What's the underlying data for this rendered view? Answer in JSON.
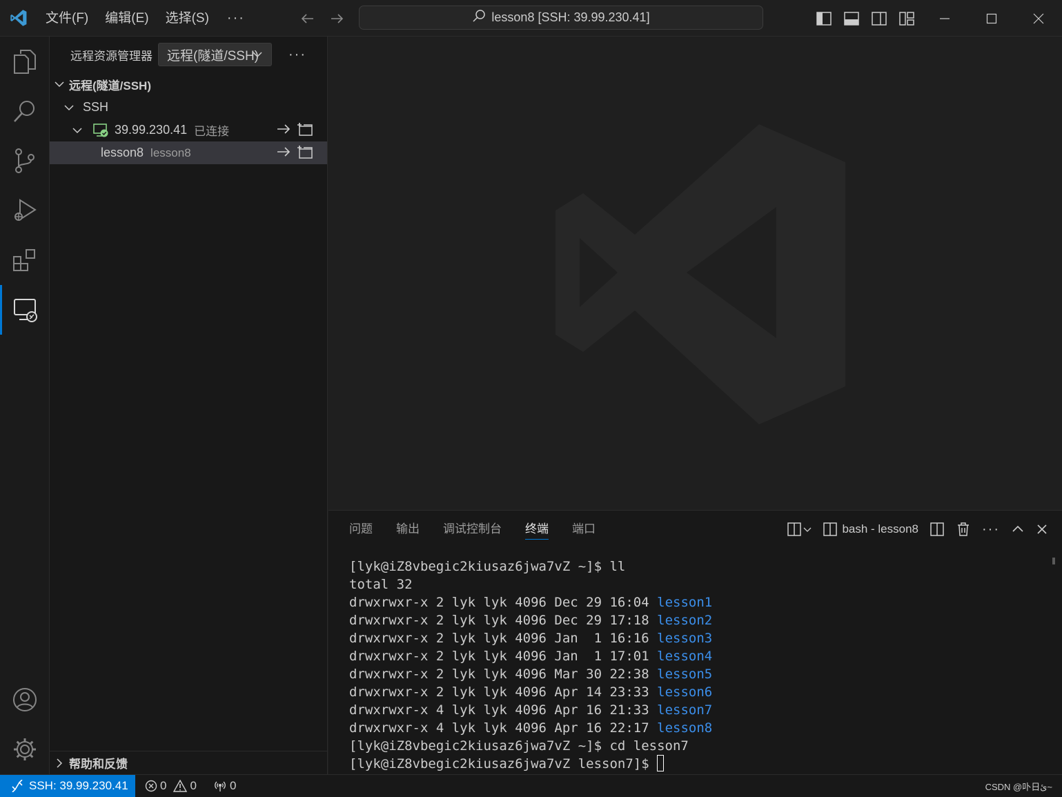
{
  "titlebar": {
    "menu": [
      "文件(F)",
      "编辑(E)",
      "选择(S)"
    ],
    "more": "···",
    "command_center": "lesson8 [SSH: 39.99.230.41]"
  },
  "sidebar": {
    "title": "远程资源管理器",
    "select_value": "远程(隧道/SSH)",
    "more": "···",
    "section": "远程(隧道/SSH)",
    "ssh_group": "SSH",
    "host": {
      "label": "39.99.230.41",
      "status": "已连接"
    },
    "folder": {
      "label": "lesson8",
      "desc": "lesson8"
    },
    "help_section": "帮助和反馈"
  },
  "panel": {
    "tabs": [
      "问题",
      "输出",
      "调试控制台",
      "终端",
      "端口"
    ],
    "active_tab": 3,
    "terminal_name": "bash - lesson8"
  },
  "terminal": {
    "lines": [
      {
        "text": "[lyk@iZ8vbegic2kiusaz6jwa7vZ ~]$ ll"
      },
      {
        "text": "total 32"
      },
      {
        "text": "drwxrwxr-x 2 lyk lyk 4096 Dec 29 16:04 ",
        "dir": "lesson1"
      },
      {
        "text": "drwxrwxr-x 2 lyk lyk 4096 Dec 29 17:18 ",
        "dir": "lesson2"
      },
      {
        "text": "drwxrwxr-x 2 lyk lyk 4096 Jan  1 16:16 ",
        "dir": "lesson3"
      },
      {
        "text": "drwxrwxr-x 2 lyk lyk 4096 Jan  1 17:01 ",
        "dir": "lesson4"
      },
      {
        "text": "drwxrwxr-x 2 lyk lyk 4096 Mar 30 22:38 ",
        "dir": "lesson5"
      },
      {
        "text": "drwxrwxr-x 2 lyk lyk 4096 Apr 14 23:33 ",
        "dir": "lesson6"
      },
      {
        "text": "drwxrwxr-x 4 lyk lyk 4096 Apr 16 21:33 ",
        "dir": "lesson7"
      },
      {
        "text": "drwxrwxr-x 4 lyk lyk 4096 Apr 16 22:17 ",
        "dir": "lesson8"
      },
      {
        "text": "[lyk@iZ8vbegic2kiusaz6jwa7vZ ~]$ cd lesson7"
      },
      {
        "text": "[lyk@iZ8vbegic2kiusaz6jwa7vZ lesson7]$ ",
        "cursor": true
      }
    ]
  },
  "statusbar": {
    "remote": "SSH: 39.99.230.41",
    "errors": "0",
    "warnings": "0",
    "ports": "0",
    "watermark": "CSDN @卟日ئ~"
  },
  "colors": {
    "accent": "#0078d4",
    "directory": "#3b8eea",
    "connected": "#89d185"
  }
}
